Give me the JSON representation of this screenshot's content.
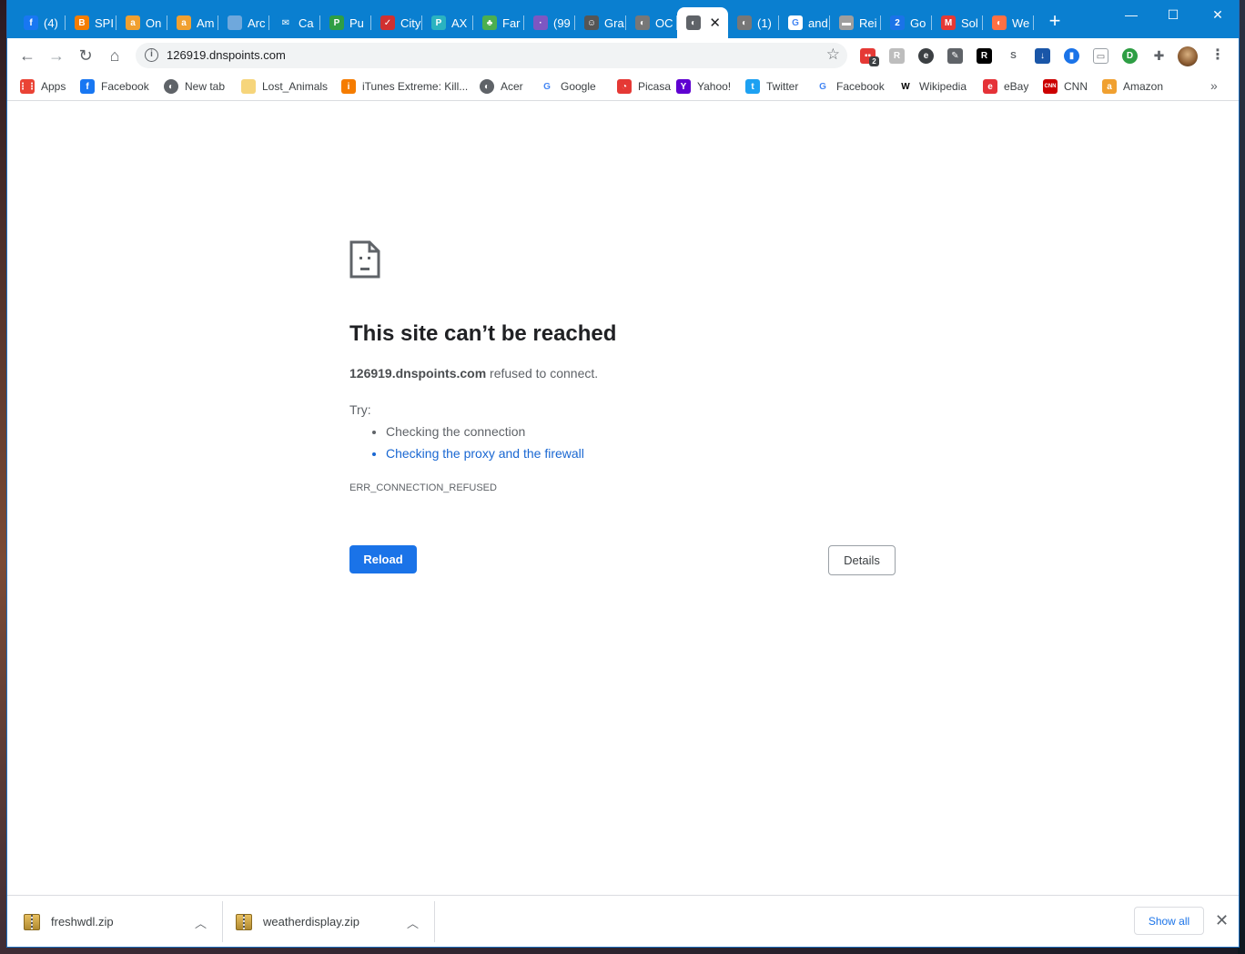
{
  "tabs": [
    {
      "label": "(4)",
      "icon": "facebook-icon",
      "color": "#1877f2",
      "glyph": "f"
    },
    {
      "label": "SPI",
      "icon": "blogger-icon",
      "color": "#f57d00",
      "glyph": "B"
    },
    {
      "label": "On",
      "icon": "amazon-icon",
      "color": "#f0a030",
      "glyph": "a"
    },
    {
      "label": "Am",
      "icon": "amazon-icon",
      "color": "#f0a030",
      "glyph": "a"
    },
    {
      "label": "Arc",
      "icon": "archive-icon",
      "color": "#6fa8dc",
      "glyph": ""
    },
    {
      "label": "Ca",
      "icon": "mail-icon",
      "color": "#0a7fd0",
      "glyph": "✉"
    },
    {
      "label": "Pu",
      "icon": "pushbullet-icon",
      "color": "#2e9e44",
      "glyph": "P"
    },
    {
      "label": "City",
      "icon": "city-icon",
      "color": "#d03030",
      "glyph": "✓"
    },
    {
      "label": "AX",
      "icon": "p-icon",
      "color": "#2bb3c0",
      "glyph": "P"
    },
    {
      "label": "Far",
      "icon": "tree-icon",
      "color": "#4caf50",
      "glyph": "♣"
    },
    {
      "label": "(99",
      "icon": "dots-icon",
      "color": "#7e57c2",
      "glyph": "·"
    },
    {
      "label": "Gra",
      "icon": "person-icon",
      "color": "#555555",
      "glyph": "☺"
    },
    {
      "label": "OC",
      "icon": "globe-icon",
      "color": "#777777",
      "glyph": "◐"
    },
    {
      "label": "",
      "icon": "globe-icon",
      "color": "#5f6368",
      "glyph": "◐",
      "active": true
    },
    {
      "label": "(1)",
      "icon": "globe-icon",
      "color": "#777777",
      "glyph": "◐"
    },
    {
      "label": "and",
      "icon": "google-icon",
      "color": "#ffffff",
      "glyph": "G"
    },
    {
      "label": "Rei",
      "icon": "page-icon",
      "color": "#9e9e9e",
      "glyph": "▬"
    },
    {
      "label": "Go",
      "icon": "calendar-icon",
      "color": "#1a73e8",
      "glyph": "2"
    },
    {
      "label": "Sol",
      "icon": "sol-icon",
      "color": "#e53935",
      "glyph": "M"
    },
    {
      "label": "We",
      "icon": "weather-icon",
      "color": "#ff7043",
      "glyph": "◐"
    }
  ],
  "window_controls": {
    "minimize": "—",
    "maximize": "☐",
    "close": "✕"
  },
  "toolbar": {
    "url": "126919.dnspoints.com",
    "ext_badge": "2"
  },
  "bookmarks": [
    {
      "label": "Apps",
      "icon": "apps-grid-icon",
      "color": "#ea4335",
      "glyph": "⋮⋮"
    },
    {
      "label": "Facebook",
      "icon": "facebook-icon",
      "color": "#1877f2",
      "glyph": "f"
    },
    {
      "label": "New tab",
      "icon": "globe-icon",
      "color": "#5f6368",
      "glyph": "◐"
    },
    {
      "label": "Lost_Animals",
      "icon": "folder-icon",
      "color": "#f6d57b",
      "glyph": ""
    },
    {
      "label": "iTunes Extreme: Kill...",
      "icon": "itunes-icon",
      "color": "#f57c00",
      "glyph": "i"
    },
    {
      "label": "Acer",
      "icon": "globe-icon",
      "color": "#5f6368",
      "glyph": "◐"
    },
    {
      "label": "Google",
      "icon": "google-icon",
      "color": "#ffffff",
      "glyph": "G"
    },
    {
      "label": "Picasa",
      "icon": "picasa-icon",
      "color": "#e53935",
      "glyph": "◔"
    },
    {
      "label": "Yahoo!",
      "icon": "yahoo-icon",
      "color": "#5f01d1",
      "glyph": "Y"
    },
    {
      "label": "Twitter",
      "icon": "twitter-icon",
      "color": "#1da1f2",
      "glyph": "t"
    },
    {
      "label": "Facebook",
      "icon": "google-icon",
      "color": "#ffffff",
      "glyph": "G"
    },
    {
      "label": "Wikipedia",
      "icon": "wikipedia-icon",
      "color": "#ffffff",
      "glyph": "W"
    },
    {
      "label": "eBay",
      "icon": "ebay-icon",
      "color": "#e53238",
      "glyph": "e"
    },
    {
      "label": "CNN",
      "icon": "cnn-icon",
      "color": "#cc0000",
      "glyph": "CNN"
    },
    {
      "label": "Amazon",
      "icon": "amazon-icon",
      "color": "#f0a030",
      "glyph": "a"
    }
  ],
  "error": {
    "title": "This site can’t be reached",
    "host": "126919.dnspoints.com",
    "desc_suffix": " refused to connect.",
    "try_label": "Try:",
    "suggestions": [
      "Checking the connection",
      "Checking the proxy and the firewall"
    ],
    "code": "ERR_CONNECTION_REFUSED",
    "reload": "Reload",
    "details": "Details"
  },
  "downloads": {
    "items": [
      {
        "name": "freshwdl.zip"
      },
      {
        "name": "weatherdisplay.zip"
      }
    ],
    "show_all": "Show all"
  }
}
